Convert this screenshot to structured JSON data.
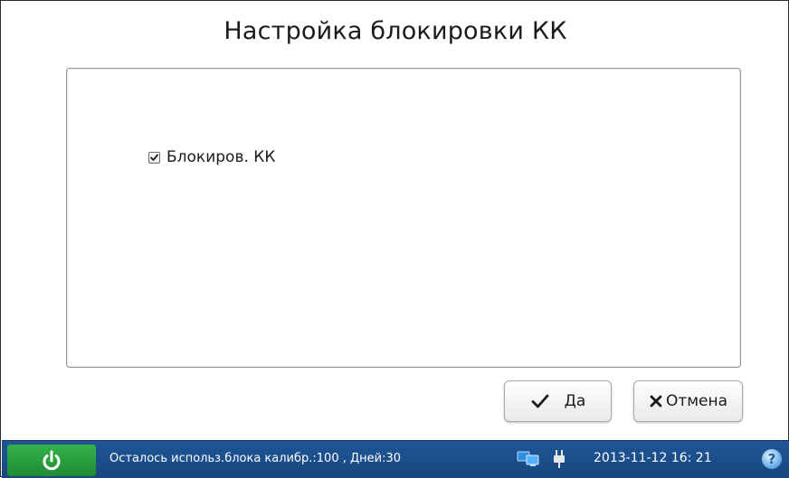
{
  "dialog": {
    "title": "Настройка блокировки КК"
  },
  "content": {
    "checkbox": {
      "label": "Блокиров. КК",
      "checked": true
    }
  },
  "buttons": {
    "ok_label": "Да",
    "ok_icon": "checkmark-icon",
    "cancel_label": "Отмена",
    "cancel_icon": "x-icon"
  },
  "taskbar": {
    "power_icon": "power-icon",
    "status_text": "Осталось использ.блока калибр.:100 , Дней:30",
    "network_icon": "network-icon",
    "plug_icon": "plug-icon",
    "datetime": "2013-11-12  16: 21",
    "help_icon": "help-icon",
    "help_glyph": "?"
  },
  "colors": {
    "taskbar": "#1f5597",
    "power_button": "#2aa140",
    "background": "#ffffff"
  }
}
